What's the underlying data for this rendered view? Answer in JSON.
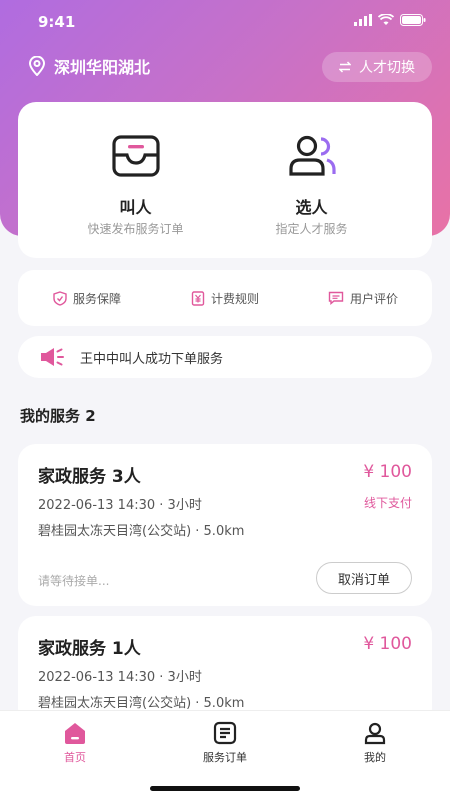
{
  "status_bar": {
    "time": "9:41"
  },
  "header": {
    "location": "深圳华阳湖北",
    "switch_label": "人才切换"
  },
  "actions": [
    {
      "title": "叫人",
      "subtitle": "快速发布服务订单",
      "icon": "inbox-icon"
    },
    {
      "title": "选人",
      "subtitle": "指定人才服务",
      "icon": "users-icon"
    }
  ],
  "features": [
    {
      "label": "服务保障",
      "icon": "shield-icon"
    },
    {
      "label": "计费规则",
      "icon": "yuan-receipt-icon"
    },
    {
      "label": "用户评价",
      "icon": "comment-icon"
    }
  ],
  "notice": {
    "text": "王中中叫人成功下单服务",
    "icon": "megaphone-icon"
  },
  "section": {
    "title": "我的服务 2"
  },
  "orders": [
    {
      "title": "家政服务 3人",
      "price": "¥ 100",
      "time": "2022-06-13 14:30 · 3小时",
      "payment": "线下支付",
      "address": "碧桂园太冻天目湾(公交站) · 5.0km",
      "status": "请等待接单...",
      "action": "取消订单"
    },
    {
      "title": "家政服务 1人",
      "price": "¥ 100",
      "time": "2022-06-13 14:30 · 3小时",
      "address": "碧桂园太冻天目湾(公交站) · 5.0km"
    }
  ],
  "tabbar": [
    {
      "label": "首页",
      "icon": "home-icon",
      "active": true
    },
    {
      "label": "服务订单",
      "icon": "orders-icon",
      "active": false
    },
    {
      "label": "我的",
      "icon": "profile-icon",
      "active": false
    }
  ],
  "colors": {
    "accent": "#e0589c",
    "gradient_start": "#b06ce0",
    "gradient_end": "#e872a6"
  }
}
